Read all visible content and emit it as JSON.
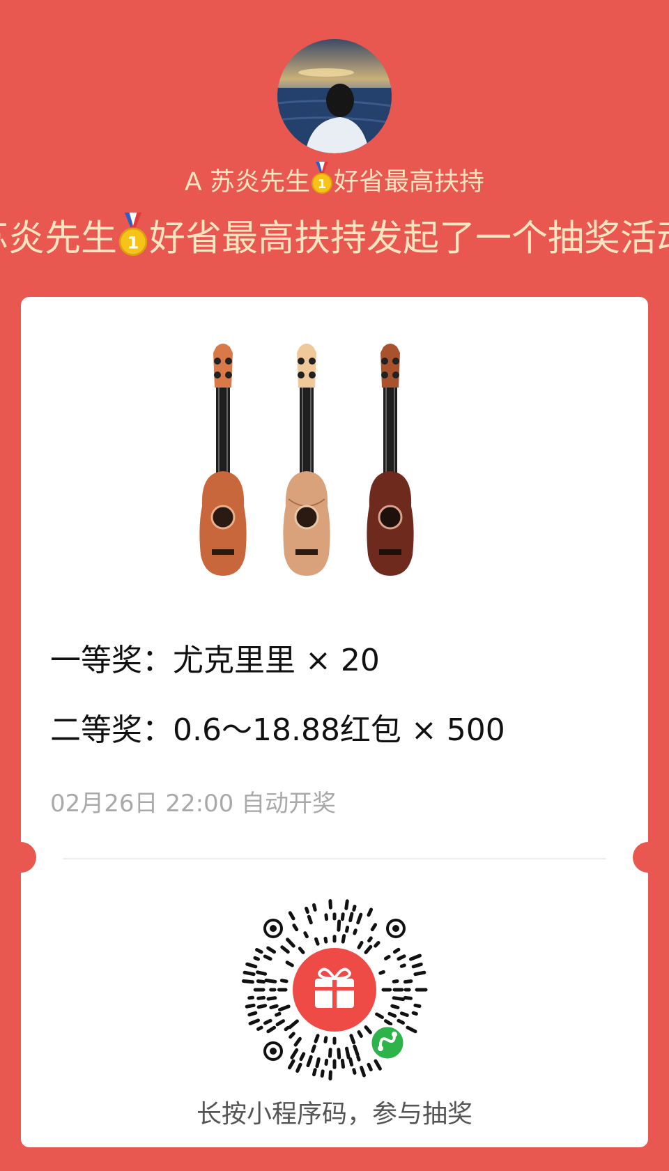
{
  "organizer": {
    "name_prefix": "A 苏炎先生",
    "name_suffix": "好省最高扶持",
    "announce_prefix": "苏炎先生",
    "announce_suffix": "好省最高扶持发起了一个抽奖活动"
  },
  "prizes": [
    {
      "text": "一等奖：尤克里里 × 20"
    },
    {
      "text": "二等奖：0.6～18.88红包 × 500"
    }
  ],
  "draw_time": "02月26日 22:00 自动开奖",
  "qr_hint": "长按小程序码，参与抽奖",
  "colors": {
    "background": "#e85750",
    "header_text": "#fbe4bf",
    "card": "#ffffff",
    "muted_text": "#a9a9a9",
    "mini_program_green": "#2eb34a"
  },
  "icons": [
    "medal-icon",
    "gift-icon",
    "mini-program-icon"
  ]
}
